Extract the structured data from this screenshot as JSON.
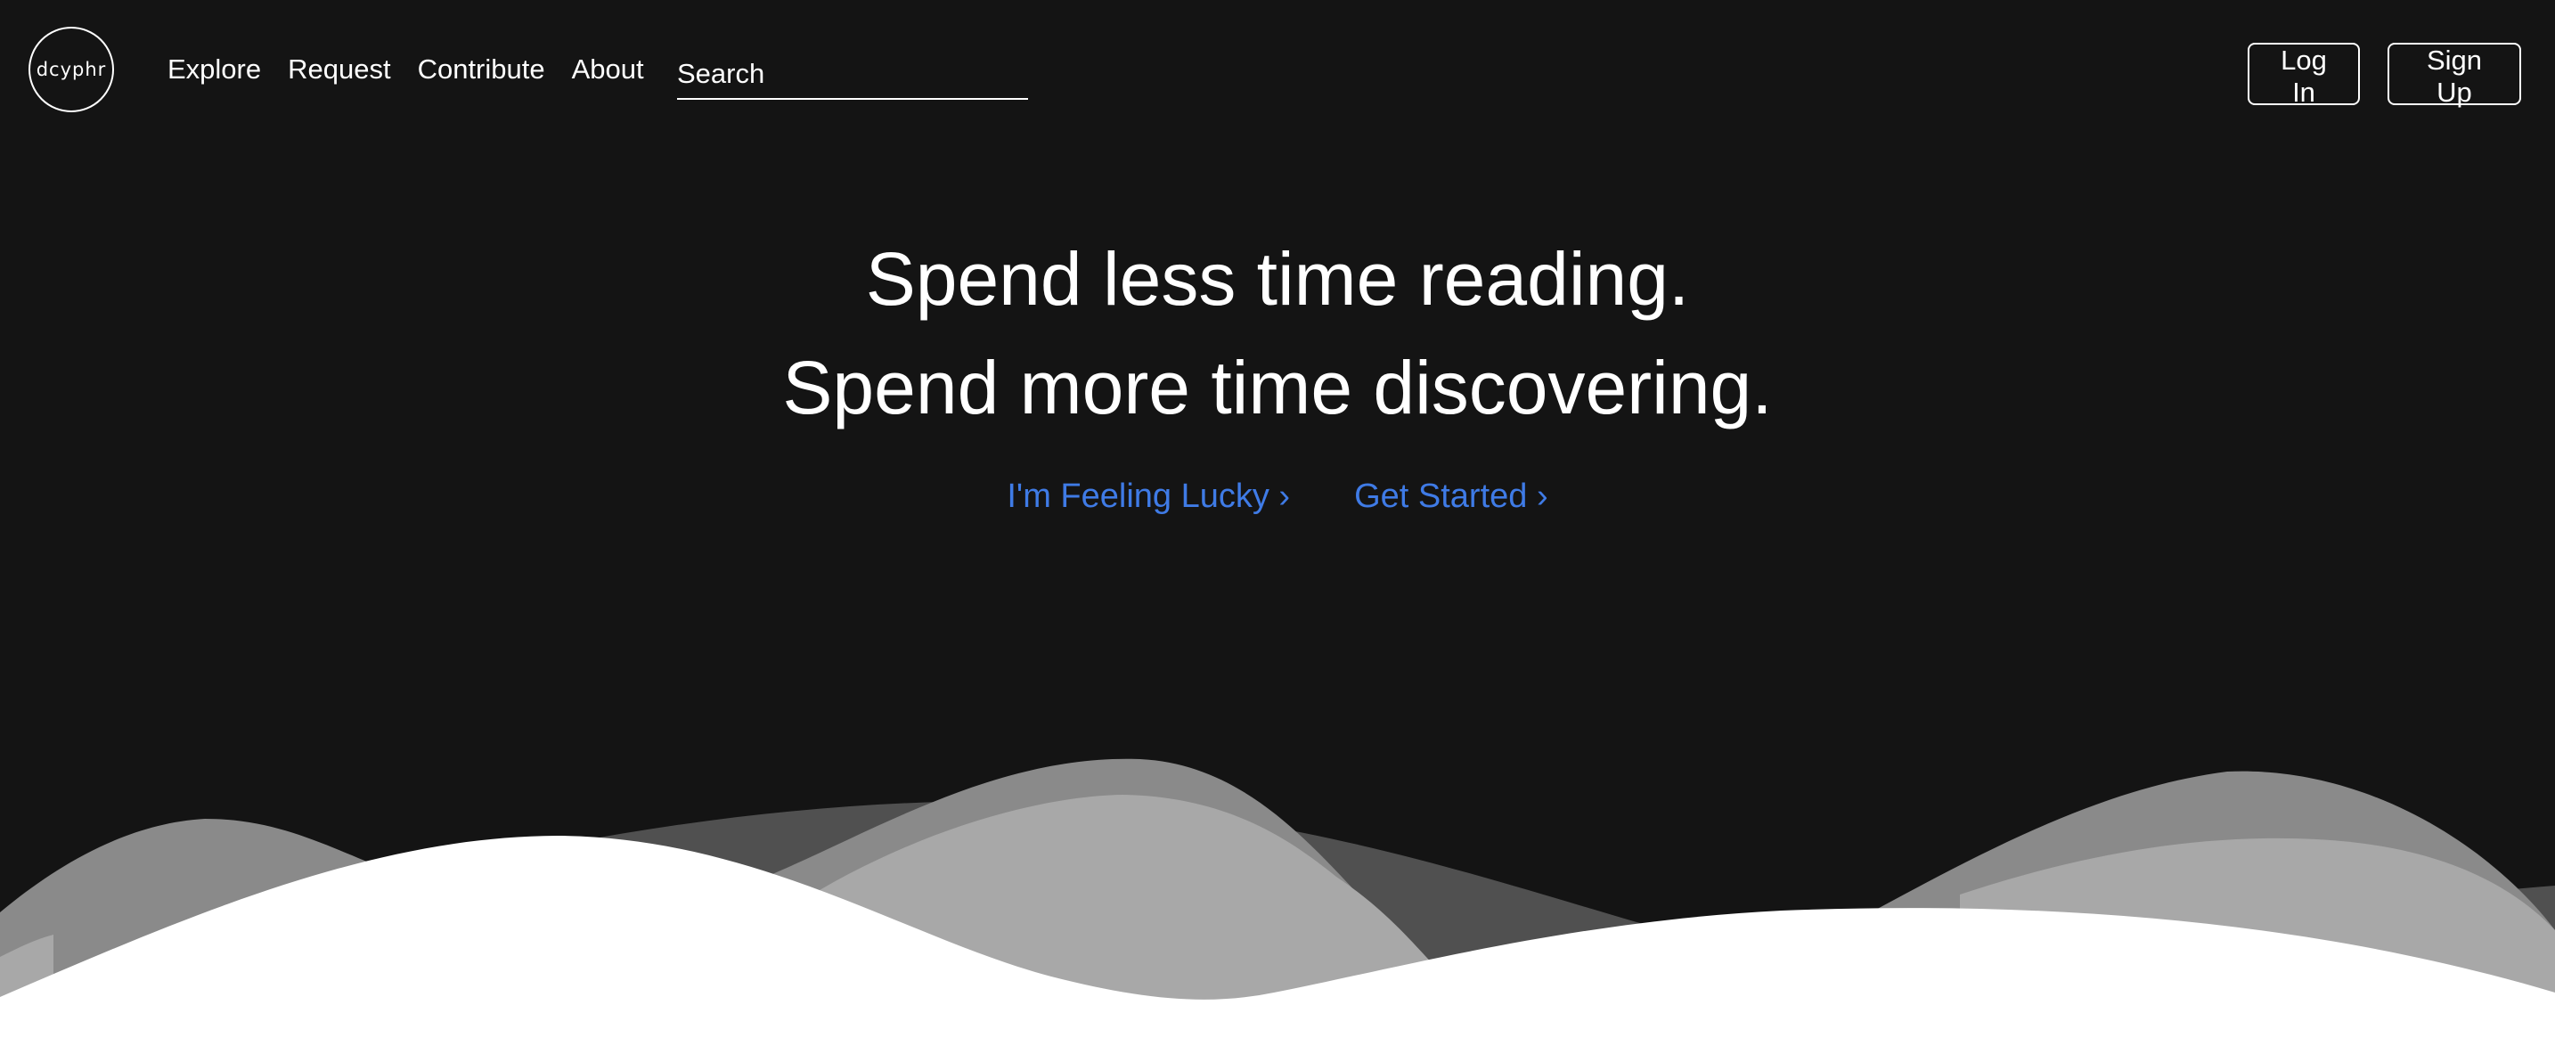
{
  "logo": {
    "text": "dcyphr"
  },
  "nav": {
    "links": [
      {
        "label": "Explore"
      },
      {
        "label": "Request"
      },
      {
        "label": "Contribute"
      },
      {
        "label": "About"
      }
    ]
  },
  "search": {
    "placeholder": "Search",
    "value": ""
  },
  "auth": {
    "login_label": "Log In",
    "signup_label": "Sign Up"
  },
  "hero": {
    "line1": "Spend less time reading.",
    "line2": "Spend more time discovering.",
    "cta_lucky": "I'm Feeling Lucky ›",
    "cta_started": "Get Started ›"
  },
  "colors": {
    "background": "#141414",
    "text": "#ffffff",
    "link": "#3f7be6",
    "wave_dark": "#505050",
    "wave_mid": "#8a8a8a",
    "wave_light": "#a8a8a8",
    "wave_front": "#ffffff"
  }
}
